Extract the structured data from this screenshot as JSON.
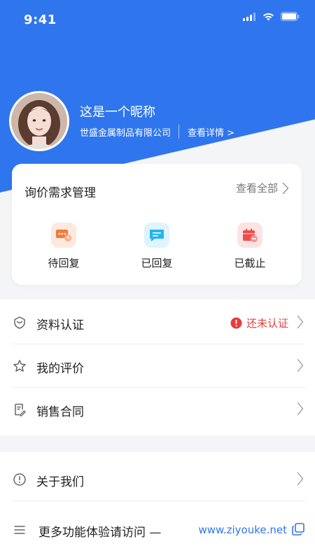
{
  "status_bar": {
    "time": "9:41"
  },
  "profile": {
    "nickname": "这是一个昵称",
    "company": "世盛金属制品有限公司",
    "detail_link": "查看详情 >"
  },
  "inquiry": {
    "title": "询价需求管理",
    "view_all": "查看全部",
    "items": [
      {
        "label": "待回复",
        "icon": "pending-message-icon",
        "color": "#f07a3c"
      },
      {
        "label": "已回复",
        "icon": "replied-message-icon",
        "color": "#27b4f0"
      },
      {
        "label": "已截止",
        "icon": "deadline-calendar-icon",
        "color": "#ee4c4c"
      }
    ]
  },
  "menu": {
    "profile_cert": {
      "label": "资料认证",
      "status": "还未认证"
    },
    "my_reviews": {
      "label": "我的评价"
    },
    "sales_contract": {
      "label": "销售合同"
    },
    "about_us": {
      "label": "关于我们"
    },
    "more_features": {
      "label": "更多功能体验请访问 —",
      "url": "www.ziyouke.net"
    }
  },
  "colors": {
    "brand_blue": "#2f76ee",
    "warning_red": "#e63c3c"
  }
}
